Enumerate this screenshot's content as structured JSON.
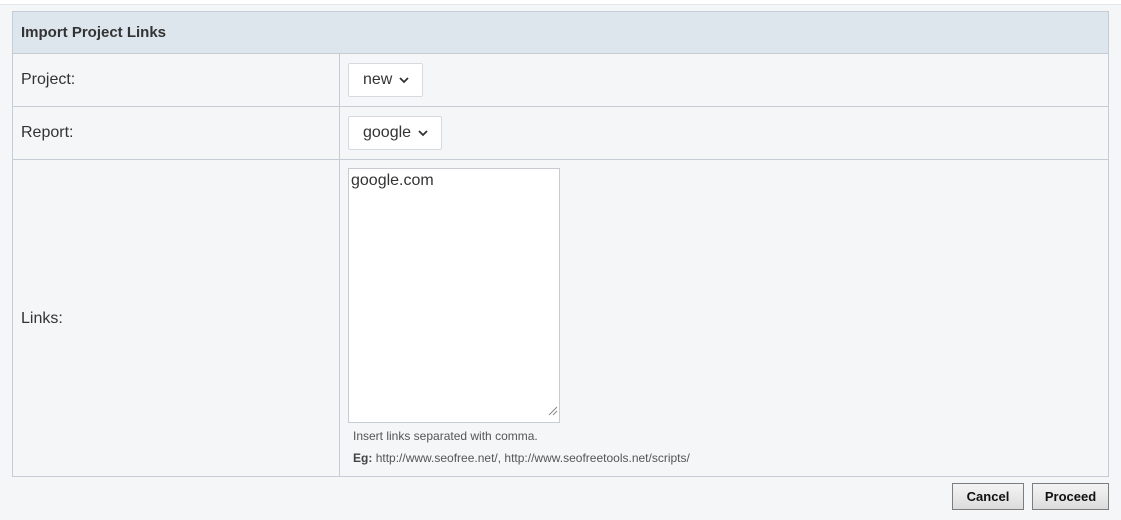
{
  "form": {
    "title": "Import Project Links",
    "project": {
      "label": "Project:",
      "value": "new"
    },
    "report": {
      "label": "Report:",
      "value": "google"
    },
    "links": {
      "label": "Links:",
      "value": "google.com",
      "hint": "Insert links separated with comma.",
      "example_prefix": "Eg:",
      "example": "http://www.seofree.net/, http://www.seofreetools.net/scripts/"
    }
  },
  "actions": {
    "cancel": "Cancel",
    "proceed": "Proceed"
  }
}
